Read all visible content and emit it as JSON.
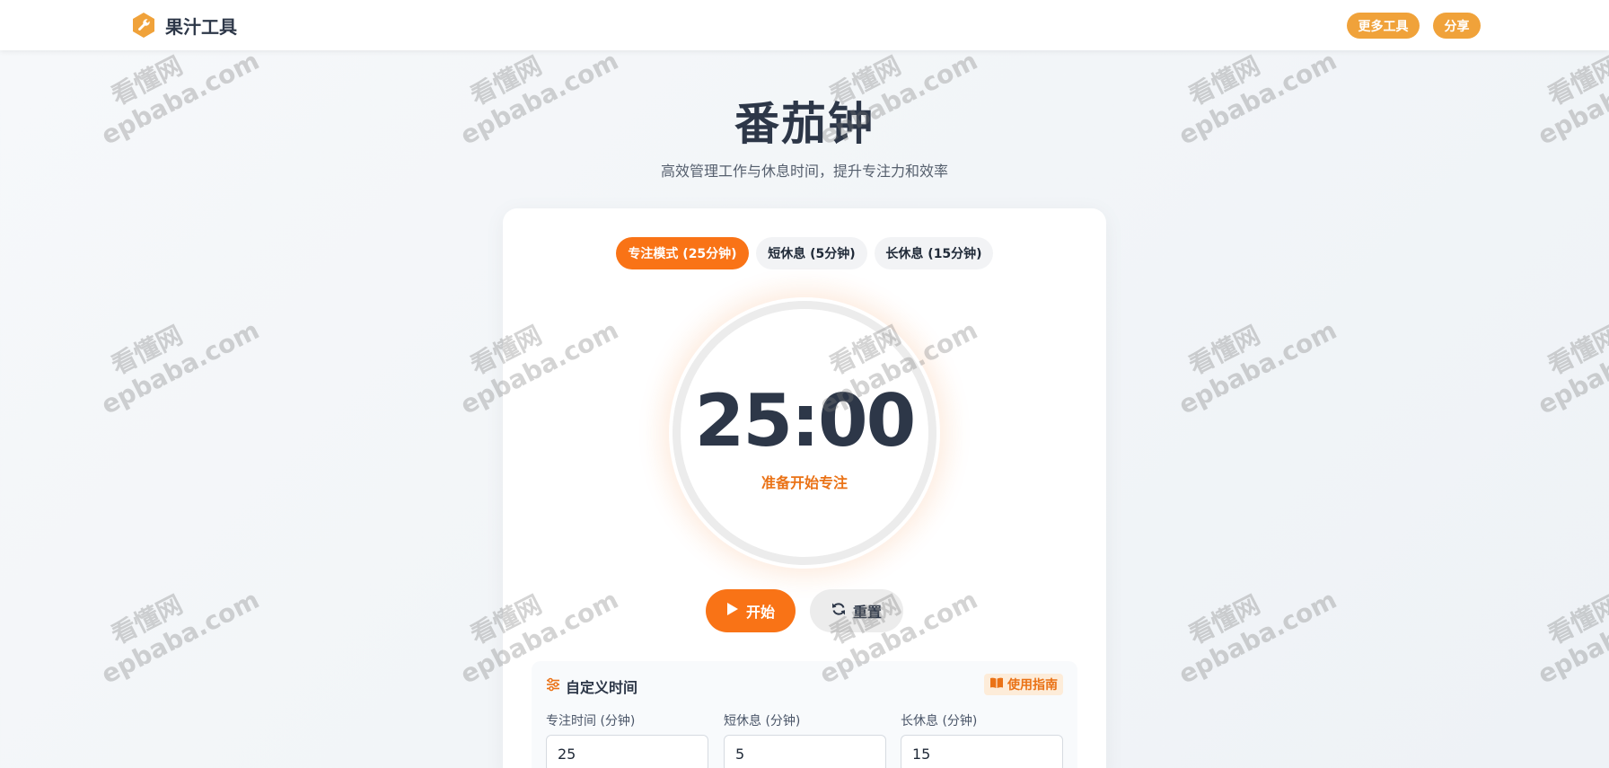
{
  "header": {
    "logo_text": "果汁工具",
    "more_tools_label": "更多工具",
    "share_label": "分享",
    "accent_color": "#f0a23a"
  },
  "page": {
    "title": "番茄钟",
    "subtitle": "高效管理工作与休息时间，提升专注力和效率"
  },
  "timer": {
    "tabs": [
      {
        "label": "专注模式 (25分钟)",
        "active": true
      },
      {
        "label": "短休息 (5分钟)",
        "active": false
      },
      {
        "label": "长休息 (15分钟)",
        "active": false
      }
    ],
    "time_display": "25:00",
    "status": "准备开始专注",
    "start_label": "开始",
    "reset_label": "重置",
    "accent_color": "#f97316"
  },
  "settings": {
    "title": "自定义时间",
    "guide_label": "使用指南",
    "fields": [
      {
        "label": "专注时间 (分钟)",
        "value": "25"
      },
      {
        "label": "短休息 (分钟)",
        "value": "5"
      },
      {
        "label": "长休息 (分钟)",
        "value": "15"
      }
    ]
  },
  "watermark": {
    "line1": "看懂网",
    "line2": "epbaba.com"
  }
}
